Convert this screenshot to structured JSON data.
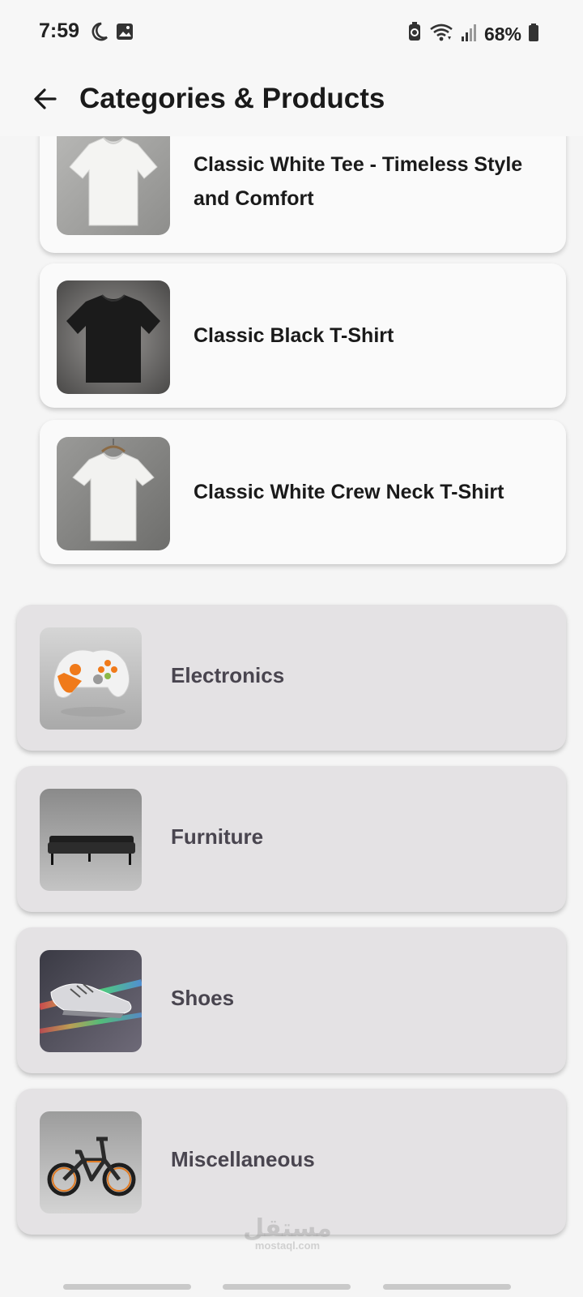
{
  "status_bar": {
    "time": "7:59",
    "battery": "68%",
    "icons": [
      "moon-icon",
      "image-icon",
      "battery-saver-icon",
      "wifi-icon",
      "signal-icon",
      "battery-icon"
    ]
  },
  "app_bar": {
    "title": "Categories & Products",
    "back_icon": "arrow-left-icon"
  },
  "products": [
    {
      "name": "Classic White Tee - Timeless Style and Comfort",
      "image": "white-tshirt"
    },
    {
      "name": "Classic Black T-Shirt",
      "image": "black-tshirt"
    },
    {
      "name": "Classic White Crew Neck T-Shirt",
      "image": "white-crew-neck-tshirt"
    }
  ],
  "categories": [
    {
      "name": "Electronics",
      "image": "game-controller"
    },
    {
      "name": "Furniture",
      "image": "sofa"
    },
    {
      "name": "Shoes",
      "image": "sneakers"
    },
    {
      "name": "Miscellaneous",
      "image": "bicycle"
    }
  ],
  "watermark": {
    "arabic": "مستقل",
    "latin": "mostaql.com"
  }
}
